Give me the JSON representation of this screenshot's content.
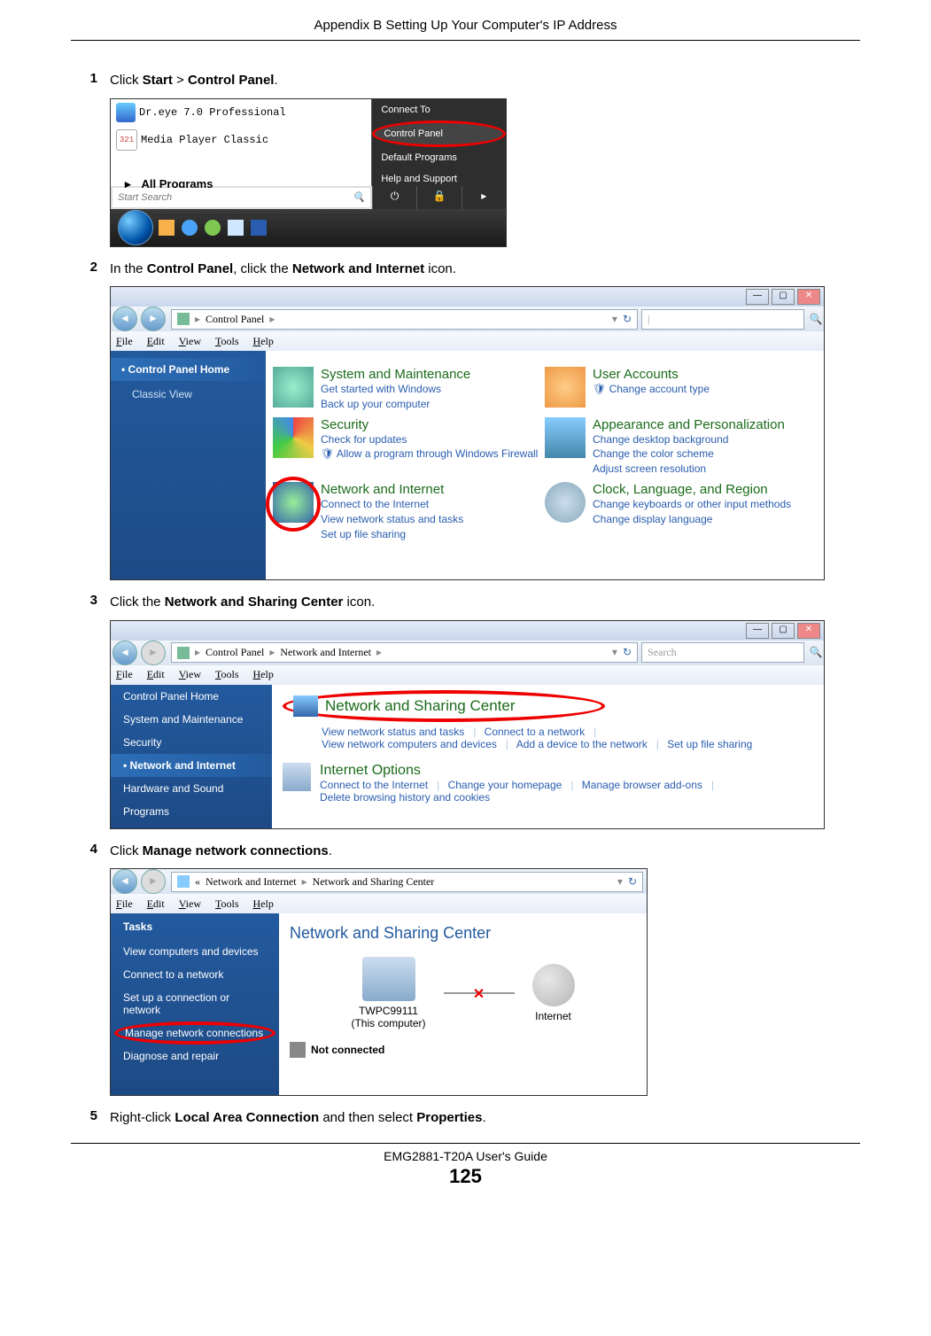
{
  "header": "Appendix B Setting Up Your Computer's IP Address",
  "steps": {
    "s1": {
      "num": "1",
      "pre": "Click ",
      "b1": "Start",
      "mid": " > ",
      "b2": "Control Panel",
      "post": "."
    },
    "s2": {
      "num": "2",
      "pre": "In the ",
      "b1": "Control Panel",
      "mid": ", click the ",
      "b2": "Network and Internet",
      "post": " icon."
    },
    "s3": {
      "num": "3",
      "pre": "Click the ",
      "b1": "Network and Sharing Center",
      "post": " icon."
    },
    "s4": {
      "num": "4",
      "pre": "Click ",
      "b1": "Manage network connections",
      "post": "."
    },
    "s5": {
      "num": "5",
      "pre": "Right-click ",
      "b1": "Local Area Connection",
      "mid": " and then select ",
      "b2": "Properties",
      "post": "."
    }
  },
  "shot1": {
    "prog1": "Dr.eye 7.0 Professional",
    "prog2": "Media Player Classic",
    "icon2_txt": "321",
    "allprog": "All Programs",
    "r1": "Connect To",
    "r2": "Control Panel",
    "r3": "Default Programs",
    "r4": "Help and Support",
    "search_ph": "Start Search",
    "mag": "🔍",
    "power": "⏻",
    "lock": "🔒",
    "arr": "▸"
  },
  "shot2": {
    "path": "Control Panel",
    "sep": "▸",
    "search_ph": "|",
    "menu": {
      "file": "File",
      "edit": "Edit",
      "view": "View",
      "tools": "Tools",
      "help": "Help"
    },
    "side": {
      "home": "Control Panel Home",
      "classic": "Classic View"
    },
    "cats": {
      "sm": {
        "t": "System and Maintenance",
        "l1": "Get started with Windows",
        "l2": "Back up your computer"
      },
      "ua": {
        "t": "User Accounts",
        "l1": "Change account type"
      },
      "sec": {
        "t": "Security",
        "l1": "Check for updates",
        "l2": "Allow a program through Windows Firewall"
      },
      "ap": {
        "t": "Appearance and Personalization",
        "l1": "Change desktop background",
        "l2": "Change the color scheme",
        "l3": "Adjust screen resolution"
      },
      "ni": {
        "t": "Network and Internet",
        "l1": "Connect to the Internet",
        "l2": "View network status and tasks",
        "l3": "Set up file sharing"
      },
      "clr": {
        "t": "Clock, Language, and Region",
        "l1": "Change keyboards or other input methods",
        "l2": "Change display language"
      }
    }
  },
  "shot3": {
    "path1": "Control Panel",
    "path2": "Network and Internet",
    "sep": "▸",
    "search_ph": "Search",
    "menu": {
      "file": "File",
      "edit": "Edit",
      "view": "View",
      "tools": "Tools",
      "help": "Help"
    },
    "side": {
      "home": "Control Panel Home",
      "sm": "System and Maintenance",
      "sec": "Security",
      "ni": "Network and Internet",
      "hs": "Hardware and Sound",
      "pr": "Programs"
    },
    "nsc": {
      "t": "Network and Sharing Center",
      "l1": "View network status and tasks",
      "l2": "Connect to a network",
      "l3": "View network computers and devices",
      "l4": "Add a device to the network",
      "l5": "Set up file sharing"
    },
    "io": {
      "t": "Internet Options",
      "l1": "Connect to the Internet",
      "l2": "Change your homepage",
      "l3": "Manage browser add-ons",
      "l4": "Delete browsing history and cookies"
    }
  },
  "shot4": {
    "path_pre": "«",
    "path1": "Network and Internet",
    "path2": "Network and Sharing Center",
    "sep": "▸",
    "menu": {
      "file": "File",
      "edit": "Edit",
      "view": "View",
      "tools": "Tools",
      "help": "Help"
    },
    "side": {
      "tasks": "Tasks",
      "vcd": "View computers and devices",
      "ctn": "Connect to a network",
      "sucn": "Set up a connection or network",
      "mnc": "Manage network connections",
      "dr": "Diagnose and repair"
    },
    "title": "Network and Sharing Center",
    "node1": "TWPC99111",
    "node1s": "(This computer)",
    "node2": "Internet",
    "nc": "Not connected"
  },
  "footer": {
    "guide": "EMG2881-T20A User's Guide",
    "pg": "125"
  }
}
